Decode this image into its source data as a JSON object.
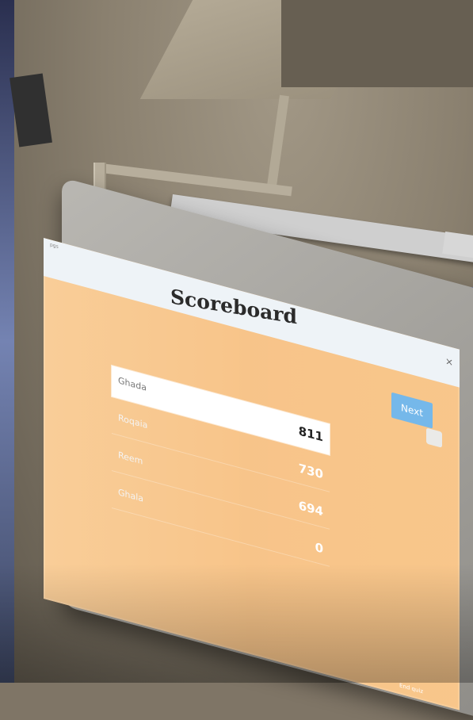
{
  "window": {
    "title": "Scoreboard",
    "small_label": "pgs",
    "close_label": "×"
  },
  "controls": {
    "next_label": "Next",
    "end_quiz_label": "End quiz"
  },
  "scores": [
    {
      "name": "Ghada",
      "score": "811"
    },
    {
      "name": "Roqaia",
      "score": "730"
    },
    {
      "name": "Reem",
      "score": "694"
    },
    {
      "name": "Ghala",
      "score": "0"
    }
  ],
  "colors": {
    "screen_background": "#f7c183",
    "header_background": "#eef3f7",
    "next_button": "#75b8ea"
  }
}
